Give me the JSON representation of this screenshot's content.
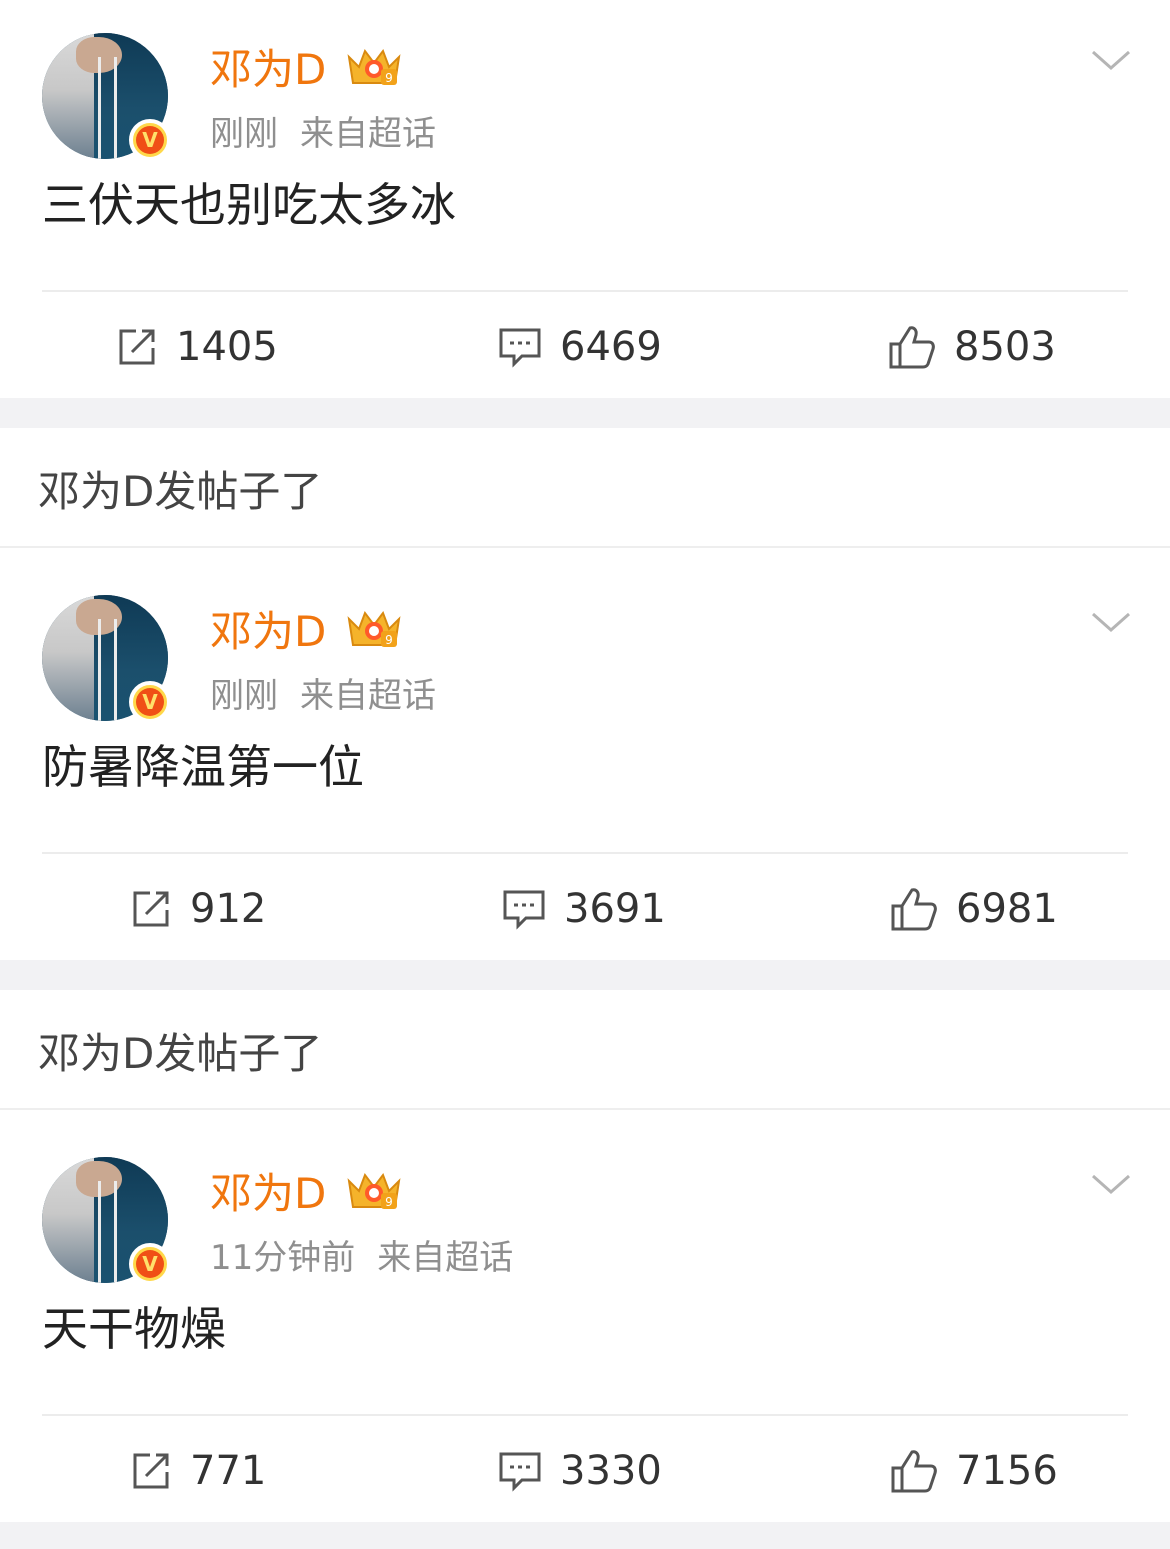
{
  "colors": {
    "username": "#f0760e",
    "meta": "#8f8f8f",
    "body_text": "#222222",
    "separator_band": "#f2f2f4",
    "verified_badge": "#f04f16",
    "drag_indicator": "#a99cf0"
  },
  "feed": {
    "posts": [
      {
        "username": "邓为D",
        "verified_mark": "V",
        "time": "刚刚",
        "source": "来自超话",
        "text": "三伏天也别吃太多冰",
        "repost_count": "1405",
        "comment_count": "6469",
        "like_count": "8503"
      },
      {
        "username": "邓为D",
        "verified_mark": "V",
        "time": "刚刚",
        "source": "来自超话",
        "text": "防暑降温第一位",
        "repost_count": "912",
        "comment_count": "3691",
        "like_count": "6981"
      },
      {
        "username": "邓为D",
        "verified_mark": "V",
        "time": "11分钟前",
        "source": "来自超话",
        "text": "天干物燥",
        "repost_count": "771",
        "comment_count": "3330",
        "like_count": "7156"
      }
    ],
    "notices": [
      {
        "text": "邓为D发帖子了"
      },
      {
        "text": "邓为D发帖子了"
      }
    ]
  },
  "icons": {
    "repost": "repost-icon",
    "comment": "comment-icon",
    "like": "thumbs-up-icon",
    "more": "chevron-down-icon",
    "level": "crown-badge-icon"
  }
}
